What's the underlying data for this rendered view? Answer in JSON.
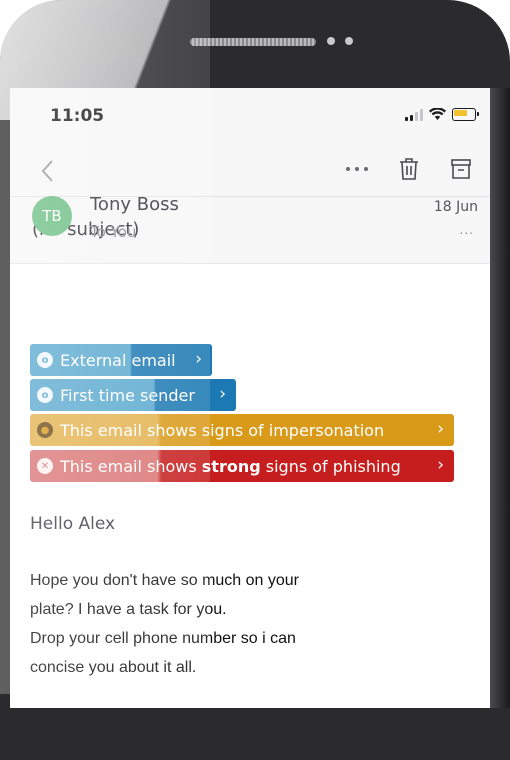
{
  "status_bar": {
    "time": "11:05",
    "icons": [
      "signal-icon",
      "wifi-icon",
      "battery-icon"
    ]
  },
  "nav": {
    "back_icon": "chevron-left-icon",
    "more_icon": "more-horizontal-icon",
    "delete_icon": "trash-icon",
    "archive_icon": "archive-icon"
  },
  "email": {
    "subject": "(no subject)",
    "avatar_initials": "TB",
    "sender": "Tony Boss",
    "recipient": "To You",
    "date": "18 Jun",
    "more": "..."
  },
  "banners": [
    {
      "text": "External email",
      "color": "#1c79b3"
    },
    {
      "text": "First time sender",
      "color": "#1c79b3"
    },
    {
      "text": "This email shows signs of impersonation",
      "color": "#d99a19"
    },
    {
      "text_before": "This email shows ",
      "text_bold": "strong",
      "text_after": " signs of phishing",
      "color": "#c61e1e"
    }
  ],
  "body": {
    "greeting": "Hello Alex",
    "lines": [
      "Hope you don't have so much on your",
      "plate? I have a task for you.",
      "Drop your cell phone number so i can",
      "concise you about it all."
    ]
  },
  "colors": {
    "avatar": "#6cbf84",
    "status_bar_bg": "#f7f7f8",
    "battery": "#f2c230"
  }
}
